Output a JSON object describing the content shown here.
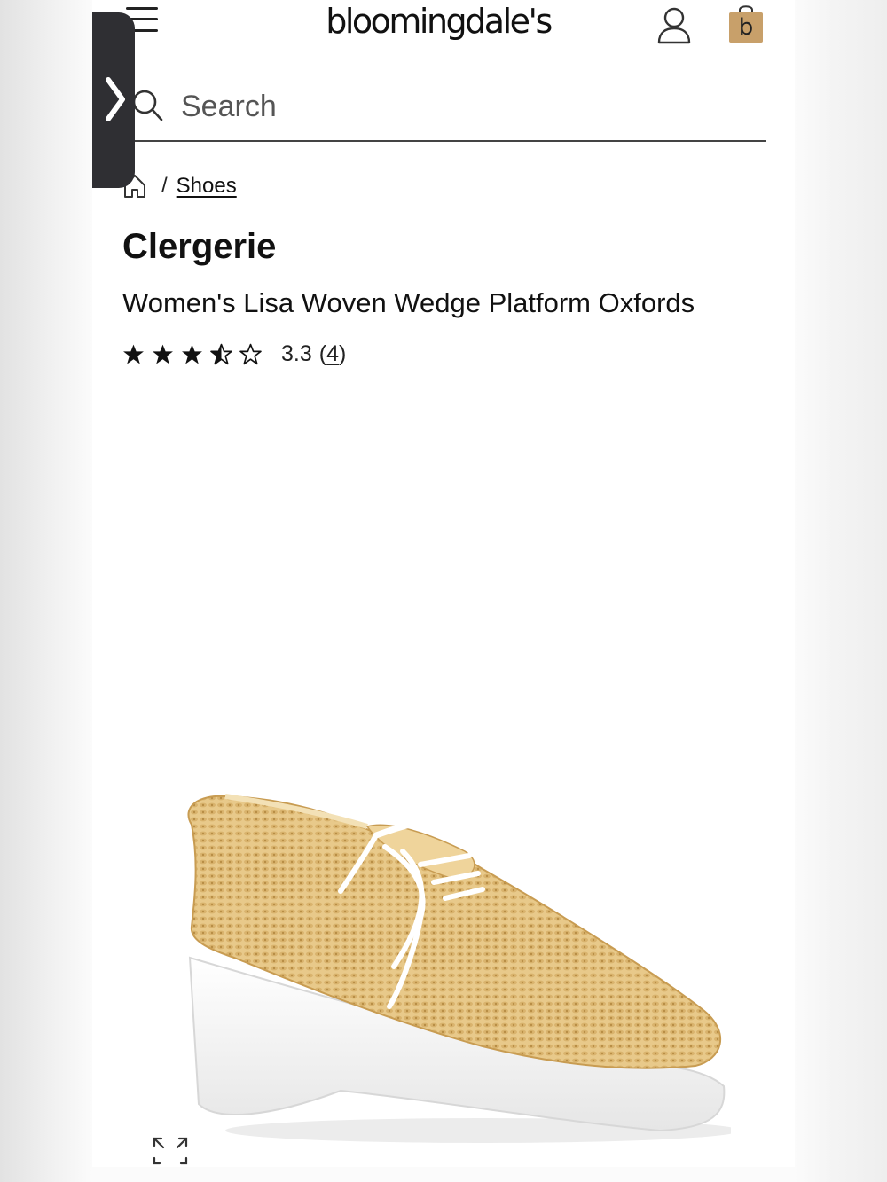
{
  "header": {
    "logo_text": "bloomingdale's",
    "bag_letter": "b",
    "bag_color": "#c8a06a"
  },
  "search": {
    "placeholder": "Search"
  },
  "breadcrumb": {
    "separator": "/",
    "items": [
      {
        "label": "Shoes"
      }
    ]
  },
  "product": {
    "brand": "Clergerie",
    "name": "Women's Lisa Woven Wedge Platform Oxfords",
    "rating": {
      "value": "3.3",
      "count_open": "(",
      "count": "4",
      "count_close": ")",
      "stars_out_of_5": 3.3
    },
    "image_colors": {
      "raffia": "#e8c98a",
      "sole": "#ffffff",
      "laces": "#ffffff"
    }
  },
  "icons": {
    "menu": "menu-icon",
    "account": "account-icon",
    "bag": "shopping-bag-icon",
    "search": "search-icon",
    "home": "home-icon",
    "expand": "expand-icon",
    "side_tab": "chevron-right-icon"
  }
}
